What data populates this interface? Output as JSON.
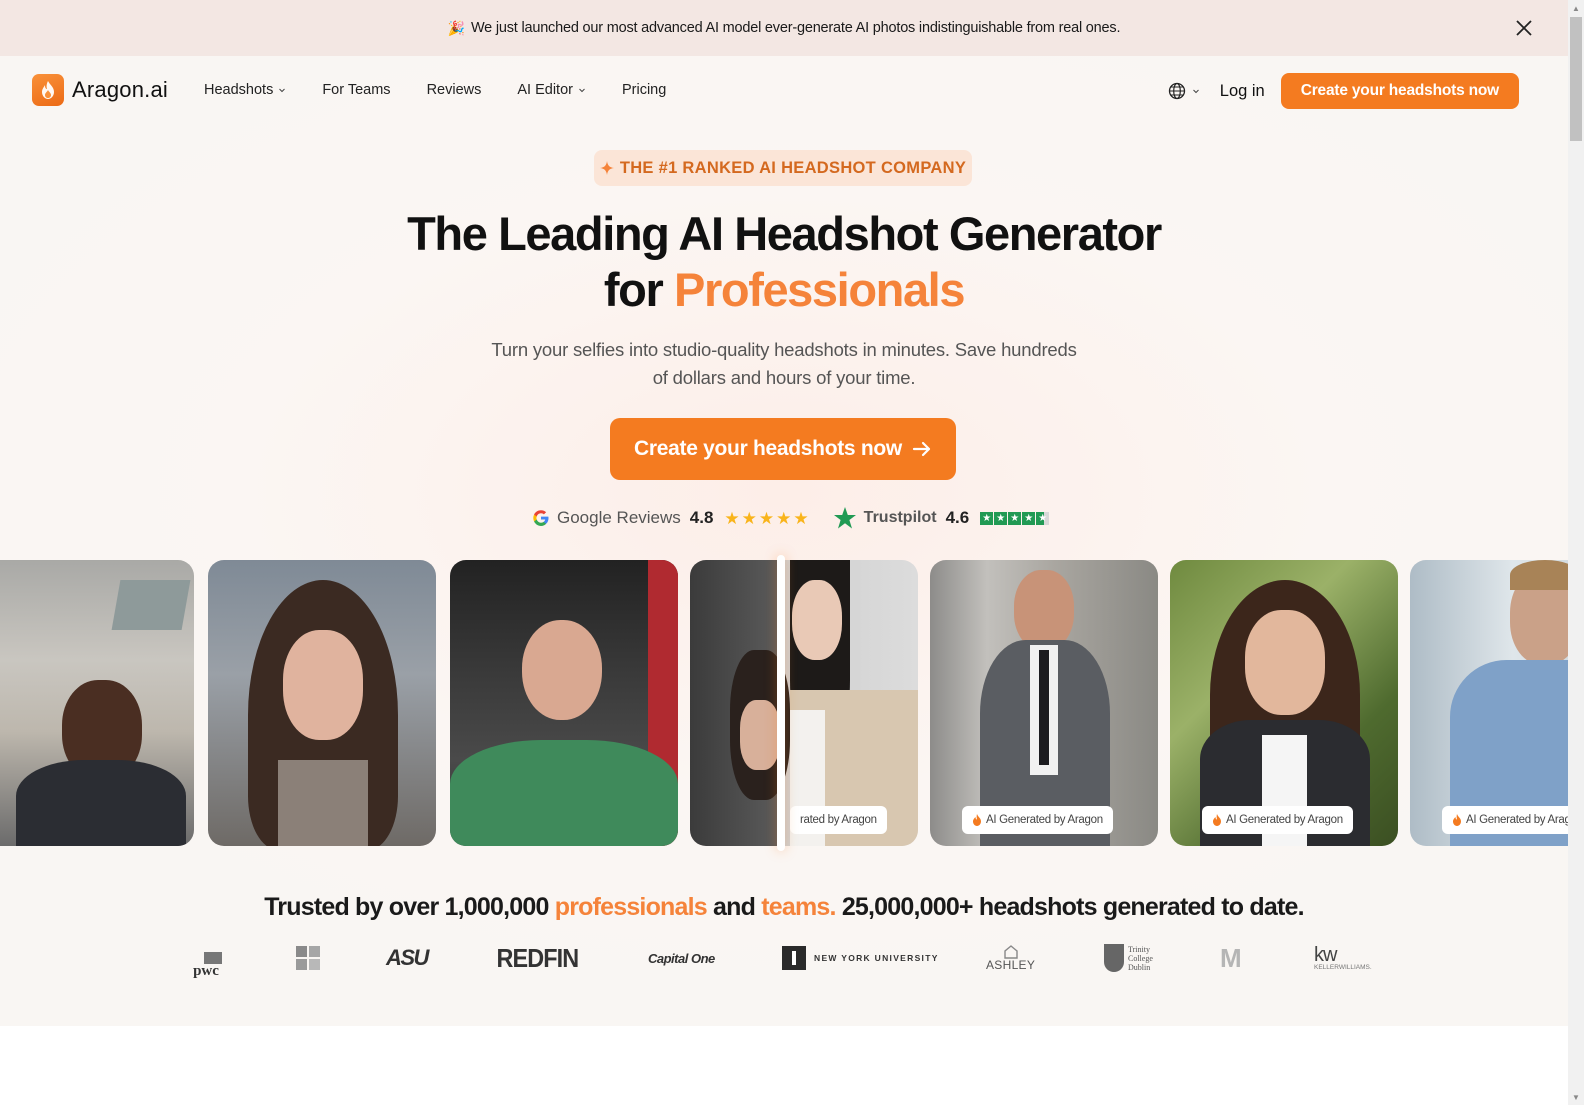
{
  "announcement": {
    "icon": "party-popper-icon",
    "text": "We just launched our most advanced AI model ever-generate AI photos indistinguishable from real ones."
  },
  "nav": {
    "logo_text": "Aragon.ai",
    "links": [
      {
        "label": "Headshots",
        "has_dropdown": true
      },
      {
        "label": "For Teams",
        "has_dropdown": false
      },
      {
        "label": "Reviews",
        "has_dropdown": false
      },
      {
        "label": "AI Editor",
        "has_dropdown": true
      },
      {
        "label": "Pricing",
        "has_dropdown": false
      }
    ],
    "login_label": "Log in",
    "cta_label": "Create your headshots now"
  },
  "hero": {
    "badge": "THE #1 RANKED AI HEADSHOT COMPANY",
    "headline_line1": "The Leading AI Headshot Generator",
    "headline_line2_prefix": "for",
    "headline_line2_accent": "Professionals",
    "subheadline": "Turn your selfies into studio-quality headshots in minutes. Save hundreds of dollars and hours of your time.",
    "cta_label": "Create your headshots now",
    "ratings": {
      "google": {
        "label": "Google Reviews",
        "score": "4.8",
        "stars": 5
      },
      "trustpilot": {
        "label": "Trustpilot",
        "score": "4.6",
        "stars": 4.5
      }
    }
  },
  "carousel": {
    "before_cards": [
      "Selfie 1",
      "Selfie 2",
      "Selfie 3",
      "Selfie 4"
    ],
    "after_badge_text": "AI Generated by Aragon",
    "after_badge_partial_text": "rated by Aragon",
    "after_badge_clipped_text": "AI Generated by Ar"
  },
  "trusted": {
    "prefix": "Trusted by over 1,000,000",
    "professionals": "professionals",
    "and": "and",
    "teams": "teams.",
    "suffix": "25,000,000+ headshots generated to date."
  },
  "logos": [
    {
      "name": "pwc",
      "text": "pwc"
    },
    {
      "name": "microsoft",
      "text": ""
    },
    {
      "name": "asu",
      "text": "ASU"
    },
    {
      "name": "redfin",
      "text": "REDFIN"
    },
    {
      "name": "capital-one",
      "text": "Capital One"
    },
    {
      "name": "nyu",
      "text": "NEW YORK UNIVERSITY"
    },
    {
      "name": "ashley",
      "text": "ASHLEY"
    },
    {
      "name": "trinity",
      "text_lines": [
        "Trinity",
        "College",
        "Dublin"
      ]
    },
    {
      "name": "michigan",
      "text": "M"
    },
    {
      "name": "keller-williams",
      "text": "kw",
      "sub": "KELLERWILLIAMS."
    }
  ],
  "colors": {
    "brand_orange": "#f47b20",
    "accent_orange": "#f5833a",
    "badge_bg": "#fbe5d7",
    "announce_bg": "#f3e7e3",
    "google_star": "#f9b41b",
    "trustpilot_green": "#219a54"
  }
}
